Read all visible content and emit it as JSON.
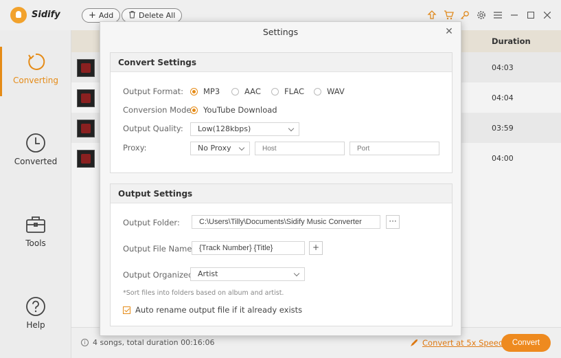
{
  "app": {
    "name": "Sidify",
    "add_label": "Add",
    "delete_all_label": "Delete All"
  },
  "sidebar": {
    "items": [
      {
        "label": "Converting",
        "icon": "converting-icon",
        "active": true
      },
      {
        "label": "Converted",
        "icon": "clock-icon"
      },
      {
        "label": "Tools",
        "icon": "toolbox-icon"
      },
      {
        "label": "Help",
        "icon": "question-icon"
      }
    ]
  },
  "list": {
    "duration_header": "Duration",
    "songs": [
      {
        "duration": "04:03"
      },
      {
        "duration": "04:04"
      },
      {
        "duration": "03:59"
      },
      {
        "duration": "04:00"
      }
    ]
  },
  "status": {
    "summary": "4 songs, total duration 00:16:06",
    "speed_link": "Convert at 5x Speed!",
    "convert_label": "Convert"
  },
  "settings": {
    "title": "Settings",
    "convert_section": {
      "title": "Convert Settings",
      "output_format_label": "Output Format:",
      "formats": [
        {
          "label": "MP3",
          "selected": true
        },
        {
          "label": "AAC"
        },
        {
          "label": "FLAC"
        },
        {
          "label": "WAV"
        }
      ],
      "conversion_mode_label": "Conversion Mode:",
      "conversion_mode_value": "YouTube Download",
      "output_quality_label": "Output Quality:",
      "output_quality_value": "Low(128kbps)",
      "proxy_label": "Proxy:",
      "proxy_value": "No Proxy",
      "host_placeholder": "Host",
      "port_placeholder": "Port"
    },
    "output_section": {
      "title": "Output Settings",
      "output_folder_label": "Output Folder:",
      "output_folder_value": "C:\\Users\\Tilly\\Documents\\Sidify Music Converter",
      "browse_label": "···",
      "output_file_name_label": "Output File Name:",
      "output_file_name_value": "{Track Number} {Title}",
      "add_label": "+",
      "output_organized_label": "Output Organized:",
      "output_organized_value": "Artist",
      "note": "*Sort files into folders based on album and artist.",
      "auto_rename_label": "Auto rename output file if it already exists",
      "auto_rename_checked": true
    }
  },
  "colors": {
    "accent": "#e58b17",
    "convert_button": "#ee8a1f"
  }
}
